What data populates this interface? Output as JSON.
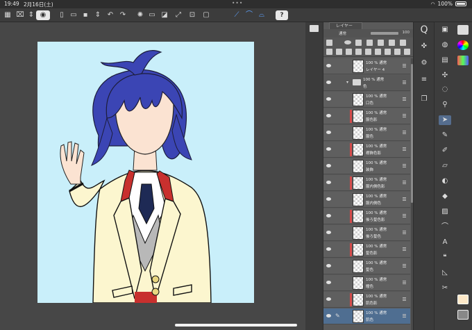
{
  "status_bar": {
    "time": "19:49",
    "date": "2月16日(土)",
    "battery": "100%"
  },
  "colors": {
    "canvas_bg": "#c9effa",
    "hair": "#3b45b4",
    "skin": "#fbe3d2",
    "jacket": "#fcf6cf",
    "collar_red": "#c8302e",
    "tie_navy": "#1e2a55",
    "selected_layer": "#4f6e91",
    "fg_swatch": "#fde8c8"
  },
  "icons": {
    "toolbar": [
      "grid-icon",
      "transform-icon",
      "updown-icon",
      "eye-icon",
      "new-file-icon",
      "open-icon",
      "save-icon",
      "arrows-icon",
      "undo-icon",
      "redo-icon",
      "loading-icon",
      "clear-icon",
      "fill-icon",
      "fit-icon",
      "crop-icon",
      "ruler-icon",
      "snap-icon",
      "snap-pen-icon",
      "help-icon"
    ]
  },
  "layer_panel": {
    "tab_label": "レイヤー",
    "blend_mode": "通常",
    "opacity": "100",
    "layers": [
      {
        "mode": "100 % 通常",
        "name": "レイヤー 4",
        "type": "layer"
      },
      {
        "mode": "100 % 通常",
        "name": "色",
        "type": "folder"
      },
      {
        "mode": "100 % 通常",
        "name": "口色",
        "type": "layer"
      },
      {
        "mode": "100 % 通常",
        "name": "服色影",
        "type": "layer",
        "red": true
      },
      {
        "mode": "100 % 通常",
        "name": "服色",
        "type": "layer"
      },
      {
        "mode": "100 % 通常",
        "name": "襟飾色影",
        "type": "layer",
        "red": true
      },
      {
        "mode": "100 % 通常",
        "name": "装飾",
        "type": "layer"
      },
      {
        "mode": "100 % 通常",
        "name": "服内側色影",
        "type": "layer",
        "red": true
      },
      {
        "mode": "100 % 通常",
        "name": "服内側色",
        "type": "layer"
      },
      {
        "mode": "100 % 通常",
        "name": "後ろ髪色影",
        "type": "layer",
        "red": true
      },
      {
        "mode": "100 % 通常",
        "name": "後ろ髪色",
        "type": "layer"
      },
      {
        "mode": "100 % 通常",
        "name": "髪色影",
        "type": "layer",
        "red": true
      },
      {
        "mode": "100 % 通常",
        "name": "髪色",
        "type": "layer"
      },
      {
        "mode": "100 % 通常",
        "name": "瞳色",
        "type": "layer"
      },
      {
        "mode": "100 % 通常",
        "name": "肌色影",
        "type": "layer",
        "red": true
      },
      {
        "mode": "100 % 通常",
        "name": "肌色",
        "type": "layer",
        "selected": true
      }
    ]
  }
}
